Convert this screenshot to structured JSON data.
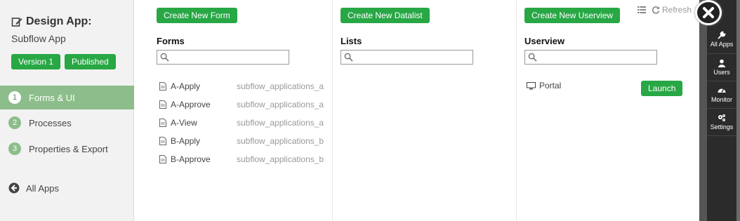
{
  "sidebar": {
    "title": "Design App:",
    "subtitle": "Subflow App",
    "version_badge": "Version 1",
    "published_badge": "Published",
    "nav": [
      {
        "num": "1",
        "label": "Forms & UI"
      },
      {
        "num": "2",
        "label": "Processes"
      },
      {
        "num": "3",
        "label": "Properties & Export"
      }
    ],
    "all_apps": "All Apps"
  },
  "forms": {
    "button": "Create New Form",
    "title": "Forms",
    "search_value": "",
    "items": [
      {
        "name": "A-Apply",
        "table": "subflow_applications_a"
      },
      {
        "name": "A-Approve",
        "table": "subflow_applications_a"
      },
      {
        "name": "A-View",
        "table": "subflow_applications_a"
      },
      {
        "name": "B-Apply",
        "table": "subflow_applications_b"
      },
      {
        "name": "B-Approve",
        "table": "subflow_applications_b"
      }
    ]
  },
  "lists": {
    "button": "Create New Datalist",
    "title": "Lists",
    "search_value": ""
  },
  "userview": {
    "button": "Create New Userview",
    "title": "Userview",
    "search_value": "",
    "item": "Portal",
    "launch": "Launch"
  },
  "toolbar": {
    "refresh": "Refresh"
  },
  "admin_bar": {
    "items": [
      {
        "label": "All Apps",
        "icon": "wrench-icon"
      },
      {
        "label": "Users",
        "icon": "user-icon"
      },
      {
        "label": "Monitor",
        "icon": "gauge-icon"
      },
      {
        "label": "Settings",
        "icon": "gears-icon"
      }
    ]
  },
  "colors": {
    "accent_green": "#28a745",
    "nav_active": "#8dbd8a",
    "admin_bar": "#2b2b2b"
  }
}
